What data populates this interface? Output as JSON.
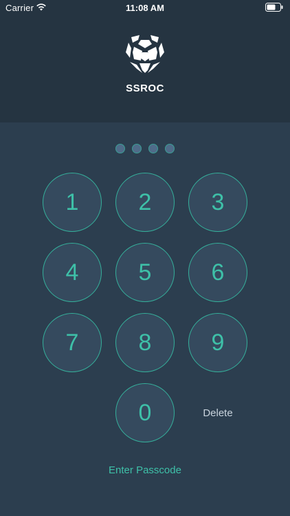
{
  "status_bar": {
    "carrier": "Carrier",
    "time": "11:08 AM"
  },
  "logo": {
    "text": "SSROC"
  },
  "passcode": {
    "dots_count": 4,
    "entered": 0
  },
  "keypad": {
    "keys": [
      "1",
      "2",
      "3",
      "4",
      "5",
      "6",
      "7",
      "8",
      "9",
      "0"
    ],
    "delete_label": "Delete"
  },
  "prompt": "Enter Passcode",
  "colors": {
    "background": "#2c3e4f",
    "header": "#253441",
    "accent": "#3ec0a8",
    "dot_fill": "#4f6b89"
  }
}
